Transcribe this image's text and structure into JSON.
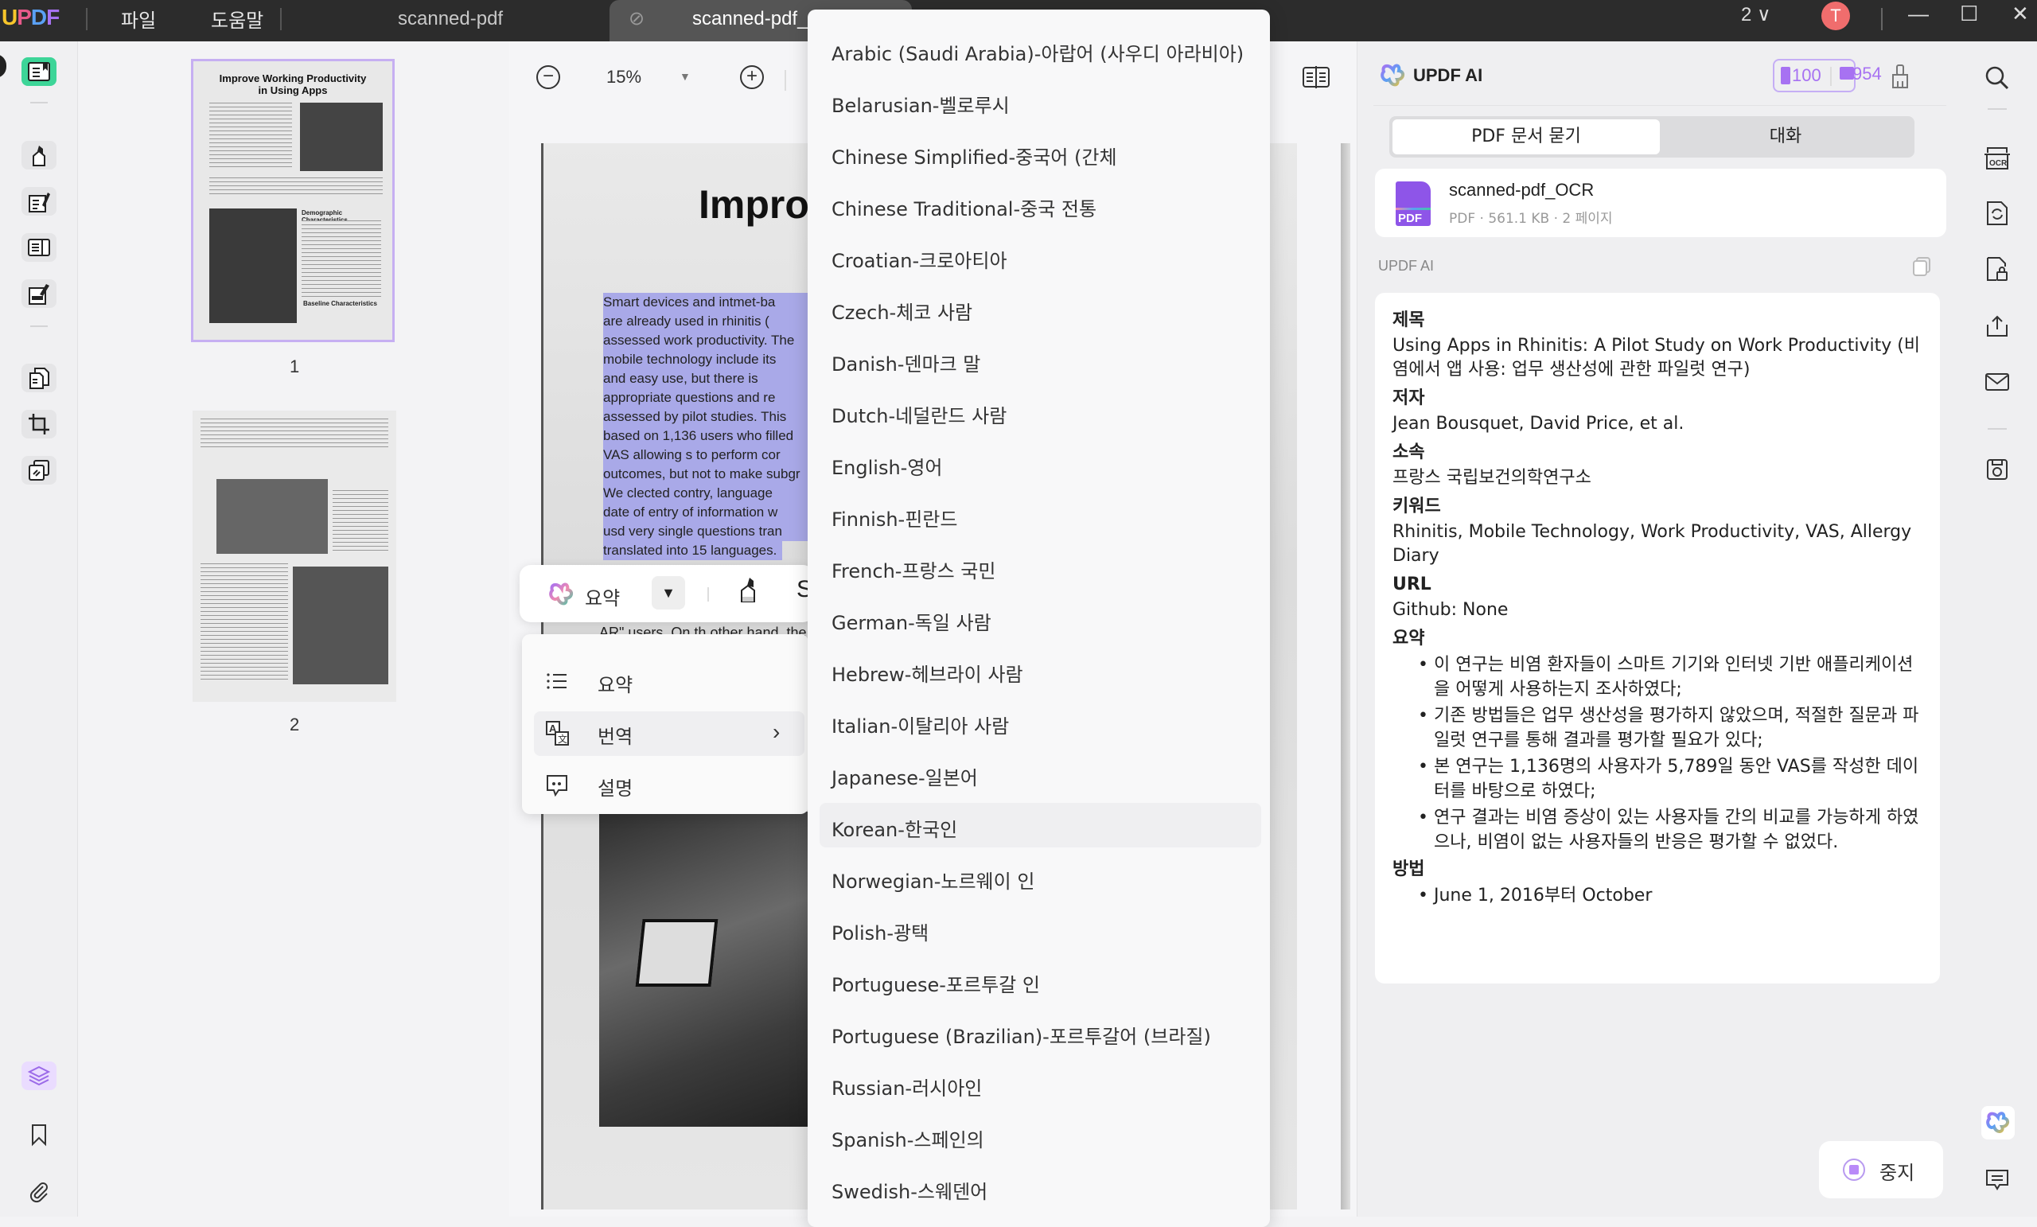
{
  "app": {
    "logo": [
      "U",
      "P",
      "D",
      "F"
    ],
    "menu": [
      "파일",
      "도움말"
    ],
    "tabs": [
      {
        "label": "scanned-pdf",
        "active": false
      },
      {
        "label": "scanned-pdf_OCR",
        "active": true
      }
    ],
    "page_count_selector": "2 ∨",
    "avatar_initial": "T",
    "window_controls": {
      "minimize": "—",
      "maximize": "☐",
      "close": "✕"
    }
  },
  "zoom_bar": {
    "zoom_value": "15%"
  },
  "thumbnails": [
    {
      "page": "1",
      "selected": true,
      "title": "Improve Working Productivity in Using Apps",
      "section_1": "Demographic Characteristics",
      "section_2": "Baseline Characteristics"
    },
    {
      "page": "2",
      "selected": false
    }
  ],
  "document": {
    "heading_fragment": "Improve",
    "selected_lines": [
      "Smart devices and intmet-ba",
      "are already used in rhinitis (",
      "assessed work productivity. The",
      "mobile technology include its",
      "and easy use, but there is",
      "appropriate questions and re",
      "assessed by pilot studies. This",
      "based on 1,136 users who filled",
      "VAS allowing s to perform cor",
      "outcomes, but not to make subgr",
      "We clected contry, language",
      "date of entry of information w",
      "usd very single questions tran",
      "translated into 15 languages."
    ],
    "below_text_fragment": "AR\" users. On th other hand, the"
  },
  "float_toolbar": {
    "ai_label": "요약",
    "dropdown_icon": "caret-down",
    "highlight_icon": "highlighter"
  },
  "context_menu": {
    "items": [
      {
        "icon": "list-icon",
        "label": "요약",
        "has_submenu": false,
        "hover": false
      },
      {
        "icon": "translate-icon",
        "label": "번역",
        "has_submenu": true,
        "hover": true
      },
      {
        "icon": "explain-icon",
        "label": "설명",
        "has_submenu": false,
        "hover": false
      }
    ]
  },
  "language_menu": {
    "highlighted": "Korean-한국인",
    "items": [
      "Arabic (Saudi Arabia)-아랍어 (사우디 아라비아)",
      "Belarusian-벨로루시",
      "Chinese Simplified-중국어 (간체",
      "Chinese Traditional-중국 전통",
      "Croatian-크로아티아",
      "Czech-체코 사람",
      "Danish-덴마크 말",
      "Dutch-네덜란드 사람",
      "English-영어",
      "Finnish-핀란드",
      "French-프랑스 국민",
      "German-독일 사람",
      "Hebrew-헤브라이 사람",
      "Italian-이탈리아 사람",
      "Japanese-일본어",
      "Korean-한국인",
      "Norwegian-노르웨이 인",
      "Polish-광택",
      "Portuguese-포르투갈 인",
      "Portuguese (Brazilian)-포르투갈어 (브라질)",
      "Russian-러시아인",
      "Spanish-스페인의",
      "Swedish-스웨덴어"
    ]
  },
  "ai_panel": {
    "title": "UPDF AI",
    "credits": {
      "docs": "100",
      "chats": "954"
    },
    "tabs": [
      {
        "label": "PDF 문서 묻기",
        "active": true
      },
      {
        "label": "대화",
        "active": false
      }
    ],
    "file": {
      "name": "scanned-pdf_OCR",
      "meta": "PDF · 561.1 KB · 2 페이지",
      "icon_label": "PDF"
    },
    "section_label": "UPDF AI",
    "answer": {
      "sections": [
        {
          "heading": "제목",
          "text": "Using Apps in Rhinitis: A Pilot Study on Work Productivity (비염에서 앱 사용: 업무 생산성에 관한 파일럿 연구)"
        },
        {
          "heading": "저자",
          "text": "Jean Bousquet, David Price, et al."
        },
        {
          "heading": "소속",
          "text": "프랑스 국립보건의학연구소"
        },
        {
          "heading": "키워드",
          "text": "Rhinitis, Mobile Technology, Work Productivity, VAS, Allergy Diary"
        },
        {
          "heading": "URL",
          "text": "Github: None"
        }
      ],
      "summary_heading": "요약",
      "summary_bullets": [
        "이 연구는 비염 환자들이 스마트 기기와 인터넷 기반 애플리케이션을 어떻게 사용하는지 조사하였다;",
        "기존 방법들은 업무 생산성을 평가하지 않았으며, 적절한 질문과 파일럿 연구를 통해 결과를 평가할 필요가 있다;",
        "본 연구는 1,136명의 사용자가 5,789일 동안 VAS를 작성한 데이터를 바탕으로 하였다;",
        "연구 결과는 비염 증상이 있는 사용자들 간의 비교를 가능하게 하였으나, 비염이 없는 사용자들의 반응은 평가할 수 없었다."
      ],
      "method_heading": "방법",
      "method_bullets": [
        "June 1, 2016부터 October"
      ]
    },
    "stop_button": "중지"
  },
  "colors": {
    "accent_purple": "#a772f2",
    "selection": "#a9a9e8",
    "active_tool_green": "#3dd598",
    "avatar_red": "#f06d6d"
  }
}
